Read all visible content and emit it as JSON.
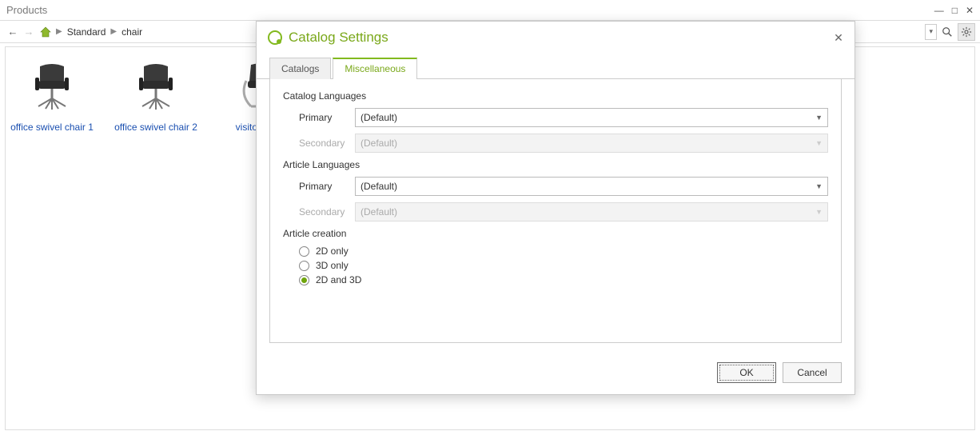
{
  "window": {
    "title": "Products"
  },
  "breadcrumb": {
    "items": [
      "Standard",
      "chair"
    ]
  },
  "products": [
    {
      "label": "office swivel chair 1"
    },
    {
      "label": "office swivel chair 2"
    },
    {
      "label": "visitor chair"
    }
  ],
  "dialog": {
    "title": "Catalog Settings",
    "tabs": {
      "catalogs": "Catalogs",
      "misc": "Miscellaneous"
    },
    "sections": {
      "catalog_lang": "Catalog Languages",
      "article_lang": "Article Languages",
      "article_creation": "Article creation"
    },
    "labels": {
      "primary": "Primary",
      "secondary": "Secondary"
    },
    "values": {
      "catalog_primary": "(Default)",
      "catalog_secondary": "(Default)",
      "article_primary": "(Default)",
      "article_secondary": "(Default)"
    },
    "radios": {
      "r2d": "2D only",
      "r3d": "3D only",
      "both": "2D and 3D"
    },
    "buttons": {
      "ok": "OK",
      "cancel": "Cancel"
    }
  }
}
